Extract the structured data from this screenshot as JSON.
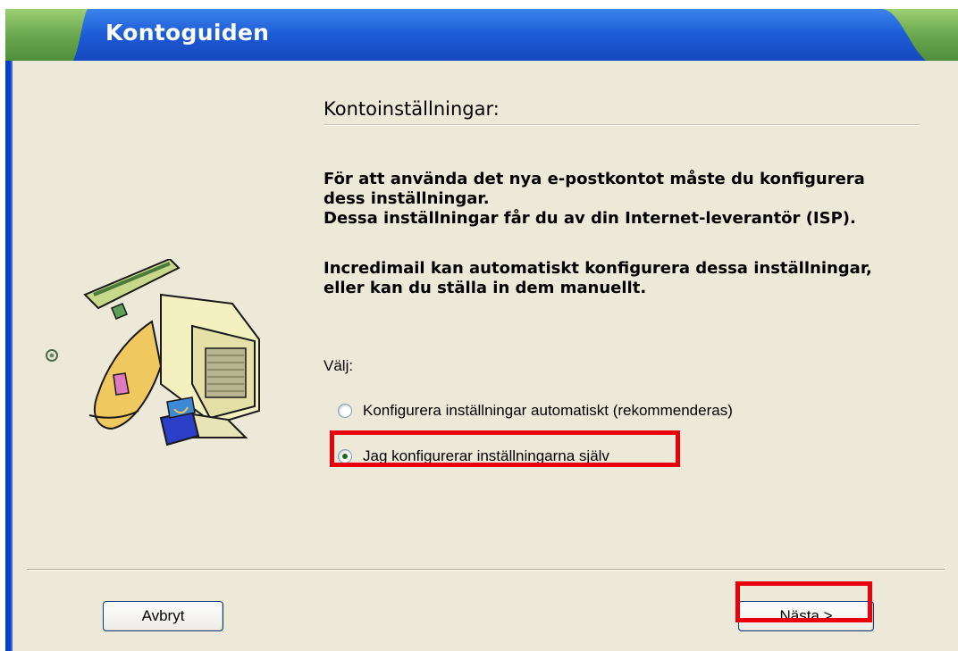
{
  "window": {
    "title": "Kontoguiden"
  },
  "page": {
    "heading": "Kontoinställningar:",
    "para_1": "För att använda det nya e-postkontot måste du konfigurera",
    "para_2": "dess inställningar.",
    "para_3": "Dessa inställningar får du av din Internet-leverantör (ISP).",
    "para_4": "Incredimail kan automatiskt konfigurera dessa inställningar,",
    "para_5": "eller kan du ställa in dem manuellt.",
    "choose_label": "Välj:",
    "options": [
      {
        "label": "Konfigurera inställningar automatiskt (rekommenderas)",
        "selected": false
      },
      {
        "label": "Jag konfigurerar inställningarna själv",
        "selected": true
      }
    ]
  },
  "buttons": {
    "cancel": "Avbryt",
    "next": "Nästa >"
  },
  "colors": {
    "titlebar_green": "#6aa84f",
    "titlebar_blue": "#1f5fd6",
    "highlight": "#e8000d",
    "background": "#ece9d8"
  },
  "icons": {
    "illustration": "computer-wizard-illustration-icon"
  }
}
